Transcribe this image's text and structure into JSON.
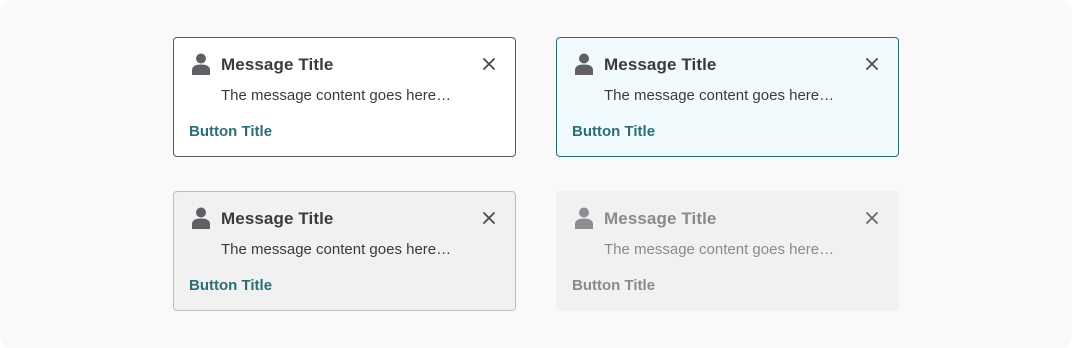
{
  "colors": {
    "page_background": "#f9f9f9",
    "text": "#3b3a3e",
    "link": "#2c6e75",
    "icon": "#606064",
    "disabled_text": "#8a8a8d",
    "active_background": "#f1fbfd",
    "active_border": "#2c6e75"
  },
  "cards": [
    {
      "state": "default",
      "icon": "person-icon",
      "title": "Message Title",
      "content": "The message content goes here…",
      "button": "Button Title",
      "close_icon": "close-icon"
    },
    {
      "state": "active",
      "icon": "person-icon",
      "title": "Message Title",
      "content": "The message content goes here…",
      "button": "Button Title",
      "close_icon": "close-icon"
    },
    {
      "state": "hover",
      "icon": "person-icon",
      "title": "Message Title",
      "content": "The message content goes here…",
      "button": "Button Title",
      "close_icon": "close-icon"
    },
    {
      "state": "disabled",
      "icon": "person-icon",
      "title": "Message Title",
      "content": "The message content goes here…",
      "button": "Button Title",
      "close_icon": "close-icon"
    }
  ]
}
